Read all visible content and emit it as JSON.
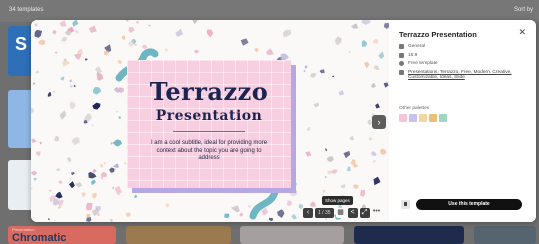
{
  "backdrop": {
    "template_count": "34 templates",
    "sort_label": "Sort by",
    "left_thumb_letter": "S",
    "bottom_thumb_small": "Presentation",
    "bottom_thumb_title": "Chromatic"
  },
  "preview": {
    "slide_title": "Terrazzo",
    "slide_subtitle": "Presentation",
    "slide_body": "I am a cool subtitle, ideal for providing more context about the topic you are going to address",
    "next_icon": "chevron-right-icon",
    "page_indicator": "1 / 35",
    "tooltip": "Show pages",
    "more_label": "•••"
  },
  "panel": {
    "title": "Terrazzo Presentation",
    "close_label": "✕",
    "meta": {
      "category": "General",
      "ratio": "16:9",
      "license": "Free template",
      "tags": "Presentations, Terrazzo, Free, Modern, Creative, Customizable, Ideas, Slide"
    },
    "palettes_label": "Other palettes",
    "palette_colors": [
      "#f4c6d7",
      "#c9c2ec",
      "#f3d7a2",
      "#e9c07a",
      "#9fd5c6"
    ],
    "use_button": "Use this template"
  },
  "colors": {
    "slide_pink": "#f7cfe0",
    "slide_title": "#1c2452",
    "accent_teal": "#6fb6c4",
    "button_black": "#111111"
  }
}
